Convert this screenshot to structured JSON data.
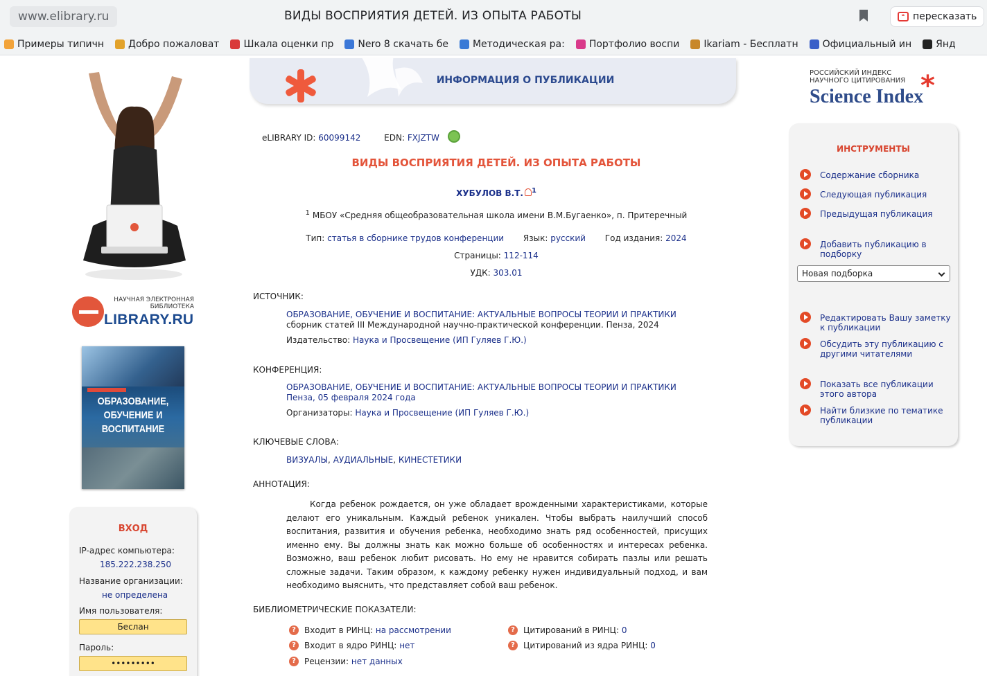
{
  "browser": {
    "url": "www.elibrary.ru",
    "title": "ВИДЫ ВОСПРИЯТИЯ ДЕТЕЙ. ИЗ ОПЫТА РАБОТЫ",
    "retell_label": "пересказать",
    "bookmarks": [
      {
        "label": "Примеры типичн",
        "color": "#f2a33a"
      },
      {
        "label": "Добро пожаловат",
        "color": "#e2a22a"
      },
      {
        "label": "Шкала оценки пр",
        "color": "#d93a3a"
      },
      {
        "label": "Nero 8 скачать бе",
        "color": "#3b78d8"
      },
      {
        "label": "Методическая ра:",
        "color": "#3a7ad6"
      },
      {
        "label": "Портфолио воспи",
        "color": "#d93a8a"
      },
      {
        "label": "Ikariam - Бесплатн",
        "color": "#c8872a"
      },
      {
        "label": "Официальный ин",
        "color": "#3a5fc8"
      },
      {
        "label": "Янд",
        "color": "#222222"
      }
    ]
  },
  "left": {
    "logo_small": "НАУЧНАЯ ЭЛЕКТРОННАЯ БИБЛИОТЕКА",
    "logo_big": "LIBRARY.RU",
    "cover_title": "ОБРАЗОВАНИЕ, ОБУЧЕНИЕ И ВОСПИТАНИЕ",
    "login": {
      "title": "ВХОД",
      "ip_label": "IP-адрес компьютера:",
      "ip_value": "185.222.238.250",
      "org_label": "Название организации:",
      "org_value": "не определена",
      "user_label": "Имя пользователя:",
      "user_value": "Беслан",
      "password_label": "Пароль:",
      "password_value": "•••••••••"
    }
  },
  "header": {
    "info_title": "ИНФОРМАЦИЯ О ПУБЛИКАЦИИ"
  },
  "publication": {
    "elibrary_id_label": "eLIBRARY ID:",
    "elibrary_id": "60099142",
    "edn_label": "EDN:",
    "edn": "FXJZTW",
    "title": "ВИДЫ ВОСПРИЯТИЯ ДЕТЕЙ. ИЗ ОПЫТА РАБОТЫ",
    "author": "ХУБУЛОВ В.Т.",
    "author_sup": "1",
    "affil_sup": "1",
    "affiliation": "МБОУ «Средняя общеобразовательная школа имени В.М.Бугаенко», п. Притеречный",
    "type_label": "Тип:",
    "type_value": "статья в сборнике трудов конференции",
    "lang_label": "Язык:",
    "lang_value": "русский",
    "year_label": "Год издания:",
    "year_value": "2024",
    "pages_label": "Страницы:",
    "pages_value": "112-114",
    "udk_label": "УДК:",
    "udk_value": "303.01"
  },
  "source": {
    "heading": "ИСТОЧНИК:",
    "title": "ОБРАЗОВАНИЕ, ОБУЧЕНИЕ И ВОСПИТАНИЕ: АКТУАЛЬНЫЕ ВОПРОСЫ ТЕОРИИ И ПРАКТИКИ",
    "desc": "сборник статей III Международной научно-практической конференции. Пенза, 2024",
    "publisher_label": "Издательство:",
    "publisher": "Наука и Просвещение (ИП Гуляев Г.Ю.)"
  },
  "conference": {
    "heading": "КОНФЕРЕНЦИЯ:",
    "title": "ОБРАЗОВАНИЕ, ОБУЧЕНИЕ И ВОСПИТАНИЕ: АКТУАЛЬНЫЕ ВОПРОСЫ ТЕОРИИ И ПРАКТИКИ",
    "place_date": "Пенза, 05 февраля 2024 года",
    "org_label": "Организаторы:",
    "org": "Наука и Просвещение (ИП Гуляев Г.Ю.)"
  },
  "keywords": {
    "heading": "КЛЮЧЕВЫЕ СЛОВА:",
    "items": [
      "ВИЗУАЛЫ",
      "АУДИАЛЬНЫЕ",
      "КИНЕСТЕТИКИ"
    ],
    "separator": ", "
  },
  "annotation": {
    "heading": "АННОТАЦИЯ:",
    "text": "Когда ребенок рождается, он уже обладает врожденными характеристиками, которые делают его уникальным. Каждый ребенок уникален. Чтобы выбрать наилучший способ воспитания, развития и обучения ребенка, необходимо знать ряд особенностей, присущих именно ему. Вы должны знать как можно больше об особенностях и интересах ребенка. Возможно, ваш ребенок любит рисовать. Но ему не нравится собирать пазлы или решать сложные задачи. Таким образом, к каждому ребенку нужен индивидуальный подход, и вам необходимо выяснить, что представляет собой ваш ребенок."
  },
  "biblio": {
    "heading": "БИБЛИОМЕТРИЧЕСКИЕ ПОКАЗАТЕЛИ:",
    "rinc_label": "Входит в РИНЦ:",
    "rinc_value": "на рассмотрении",
    "core_label": "Входит в ядро РИНЦ:",
    "core_value": "нет",
    "reviews_label": "Рецензии:",
    "reviews_value": "нет данных",
    "cit_label": "Цитирований в РИНЦ:",
    "cit_value": "0",
    "cit_core_label": "Цитирований из ядра РИНЦ:",
    "cit_core_value": "0"
  },
  "right": {
    "sci_small": "РОССИЙСКИЙ ИНДЕКС НАУЧНОГО ЦИТИРОВАНИЯ",
    "sci_big": "Science Index",
    "tools_title": "ИНСТРУМЕНТЫ",
    "tools": [
      "Содержание сборника",
      "Следующая публикация",
      "Предыдущая публикация",
      "Добавить публикацию в подборку",
      "Редактировать Вашу заметку к публикации",
      "Обсудить эту публикацию с другими читателями",
      "Показать все публикации этого автора",
      "Найти близкие по тематике публикации"
    ],
    "select_value": "Новая подборка"
  }
}
